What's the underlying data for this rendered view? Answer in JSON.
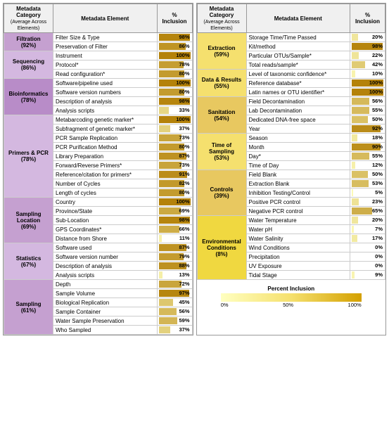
{
  "headers": {
    "col1": "Metadata Category",
    "col1sub": "(Average Across Elements)",
    "col2": "Metadata Element",
    "col3": "% Inclusion"
  },
  "left_table": {
    "sections": [
      {
        "category": "Filtration",
        "avg": "(92%)",
        "color": "cat-filtration",
        "rows": [
          {
            "element": "Filter Size & Type",
            "pct": 98
          },
          {
            "element": "Preservation of Filter",
            "pct": 86
          }
        ]
      },
      {
        "category": "Sequencing",
        "avg": "(86%)",
        "color": "cat-sequencing",
        "rows": [
          {
            "element": "Instrument",
            "pct": 100
          },
          {
            "element": "Protocol*",
            "pct": 78
          },
          {
            "element": "Read configuration*",
            "pct": 80
          }
        ]
      },
      {
        "category": "Bioinformatics",
        "avg": "(78%)",
        "color": "cat-bioinformatics",
        "rows": [
          {
            "element": "Software/pipeline used",
            "pct": 100
          },
          {
            "element": "Software version numbers",
            "pct": 80
          },
          {
            "element": "Description of analysis",
            "pct": 98
          },
          {
            "element": "Analysis scripts",
            "pct": 33
          }
        ]
      },
      {
        "category": "Primers & PCR",
        "avg": "(78%)",
        "color": "cat-primers",
        "rows": [
          {
            "element": "Metabarcoding genetic marker*",
            "pct": 100
          },
          {
            "element": "Subfragment of genetic marker*",
            "pct": 37
          },
          {
            "element": "PCR Sample Replication",
            "pct": 73
          },
          {
            "element": "PCR Purification Method",
            "pct": 80
          },
          {
            "element": "Library Preparation",
            "pct": 87
          },
          {
            "element": "Forward/Reverse Primers*",
            "pct": 73
          },
          {
            "element": "Reference/citation for primers*",
            "pct": 91
          },
          {
            "element": "Number of Cycles",
            "pct": 82
          },
          {
            "element": "Length of cycles",
            "pct": 80
          }
        ]
      },
      {
        "category": "Sampling Location",
        "avg": "(69%)",
        "color": "cat-sampling-location",
        "rows": [
          {
            "element": "Country",
            "pct": 100
          },
          {
            "element": "Province/State",
            "pct": 69
          },
          {
            "element": "Sub-Location",
            "pct": 98
          },
          {
            "element": "GPS Coordinates*",
            "pct": 66
          },
          {
            "element": "Distance from Shore",
            "pct": 11
          }
        ]
      },
      {
        "category": "Statistics",
        "avg": "(67%)",
        "color": "cat-sequencing",
        "rows": [
          {
            "element": "Software used",
            "pct": 87
          },
          {
            "element": "Software version number",
            "pct": 79
          },
          {
            "element": "Description of analysis",
            "pct": 88
          },
          {
            "element": "Analysis scripts",
            "pct": 13
          }
        ]
      },
      {
        "category": "Sampling",
        "avg": "(61%)",
        "color": "cat-sampling",
        "rows": [
          {
            "element": "Depth",
            "pct": 72
          },
          {
            "element": "Sample Volume",
            "pct": 97
          },
          {
            "element": "Biological Replication",
            "pct": 45
          },
          {
            "element": "Sample Container",
            "pct": 56
          },
          {
            "element": "Water Sample Preservation",
            "pct": 59
          },
          {
            "element": "Who Sampled",
            "pct": 37
          }
        ]
      }
    ]
  },
  "right_table": {
    "sections": [
      {
        "category": "Extraction",
        "avg": "(59%)",
        "color": "cat-extraction",
        "rows": [
          {
            "element": "Storage Time/Time Passed",
            "pct": 20
          },
          {
            "element": "Kit/method",
            "pct": 98
          },
          {
            "element": "Particular OTUs/Sample*",
            "pct": 22
          },
          {
            "element": "Total reads/sample*",
            "pct": 42
          }
        ]
      },
      {
        "category": "Data & Results",
        "avg": "(55%)",
        "color": "cat-data-results",
        "rows": [
          {
            "element": "Level of taxonomic confidence*",
            "pct": 10
          },
          {
            "element": "Reference database*",
            "pct": 100
          },
          {
            "element": "Latin names or OTU identifier*",
            "pct": 100
          }
        ]
      },
      {
        "category": "Sanitation",
        "avg": "(54%)",
        "color": "cat-sanitation",
        "rows": [
          {
            "element": "Field Decontamination",
            "pct": 56
          },
          {
            "element": "Lab Decontamination",
            "pct": 55
          },
          {
            "element": "Dedicated DNA-free space",
            "pct": 50
          },
          {
            "element": "Year",
            "pct": 92
          }
        ]
      },
      {
        "category": "Time of Sampling",
        "avg": "(53%)",
        "color": "cat-time",
        "rows": [
          {
            "element": "Season",
            "pct": 18
          },
          {
            "element": "Month",
            "pct": 90
          },
          {
            "element": "Day*",
            "pct": 55
          },
          {
            "element": "Time of Day",
            "pct": 12
          }
        ]
      },
      {
        "category": "Controls",
        "avg": "(39%)",
        "color": "cat-controls",
        "rows": [
          {
            "element": "Field Blank",
            "pct": 50
          },
          {
            "element": "Extraction Blank",
            "pct": 53
          },
          {
            "element": "Inhibition Testing/Control",
            "pct": 5
          },
          {
            "element": "Positive PCR control",
            "pct": 23
          },
          {
            "element": "Negative PCR control",
            "pct": 65
          }
        ]
      },
      {
        "category": "Environmental Conditions",
        "avg": "(8%)",
        "color": "cat-environmental",
        "rows": [
          {
            "element": "Water Temperature",
            "pct": 20
          },
          {
            "element": "Water pH",
            "pct": 7
          },
          {
            "element": "Water Salinity",
            "pct": 17
          },
          {
            "element": "Wind Conditions",
            "pct": 0
          },
          {
            "element": "Precipitation",
            "pct": 0
          },
          {
            "element": "UV Exposure",
            "pct": 0
          },
          {
            "element": "Tidal Stage",
            "pct": 9
          }
        ]
      }
    ]
  },
  "legend": {
    "title": "Percent Inclusion",
    "min_label": "0%",
    "mid_label": "50%",
    "max_label": "100%"
  }
}
